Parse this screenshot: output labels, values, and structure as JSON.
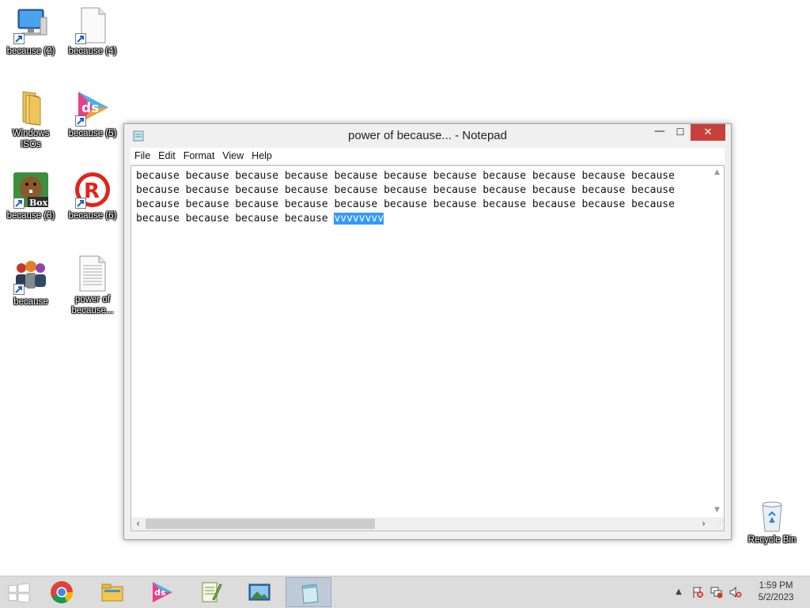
{
  "desktop": {
    "icons": [
      {
        "label": "because (2)",
        "icon": "computer-icon"
      },
      {
        "label": "because (4)",
        "icon": "blank-document-icon"
      },
      {
        "label": "Windows ISOs",
        "icon": "folder-icon"
      },
      {
        "label": "because (5)",
        "icon": "ds-app-icon"
      },
      {
        "label": "because (3)",
        "icon": "beaver-box-icon"
      },
      {
        "label": "because (6)",
        "icon": "roblox-icon"
      },
      {
        "label": "because",
        "icon": "people-icon"
      },
      {
        "label": "power of because...",
        "icon": "text-document-icon"
      }
    ],
    "recycle_bin": {
      "label": "Recycle Bin"
    }
  },
  "notepad": {
    "title": "power of because... - Notepad",
    "controls": {
      "minimize": "—",
      "maximize": "☐",
      "close": "✕"
    },
    "menu": [
      "File",
      "Edit",
      "Format",
      "View",
      "Help"
    ],
    "lines": [
      "because because because because because because because because because because because",
      "because because because because because because because because because because because",
      "because because because because because because because because because because because",
      "because because because because "
    ],
    "selected_text": "vvvvvvvv"
  },
  "taskbar": {
    "apps": [
      {
        "name": "chrome",
        "icon": "chrome-icon"
      },
      {
        "name": "file-explorer",
        "icon": "file-explorer-icon"
      },
      {
        "name": "ds-app",
        "icon": "ds-app-icon"
      },
      {
        "name": "notepad-plus-plus",
        "icon": "notepad-plus-plus-icon"
      },
      {
        "name": "photo-viewer",
        "icon": "photo-viewer-icon"
      },
      {
        "name": "notepad",
        "icon": "notepad-icon",
        "active": true
      }
    ],
    "tray": [
      "show-hidden-icons-icon",
      "action-center-flag-icon",
      "network-icon",
      "volume-muted-icon"
    ],
    "time": "1:59 PM",
    "date": "5/2/2023"
  }
}
